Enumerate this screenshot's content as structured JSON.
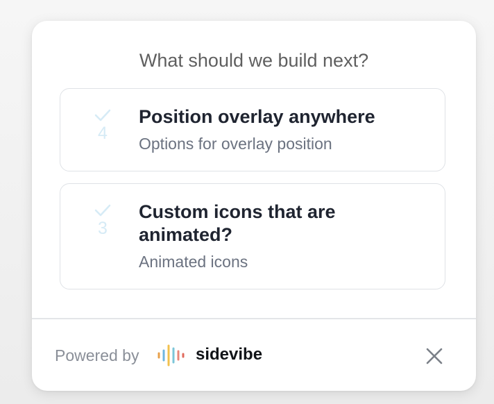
{
  "widget": {
    "title": "What should we build next?",
    "options": [
      {
        "count": "4",
        "title": "Position overlay anywhere",
        "subtitle": "Options for overlay position"
      },
      {
        "count": "3",
        "title": "Custom icons that are animated?",
        "subtitle": "Animated icons"
      }
    ]
  },
  "footer": {
    "powered_by": "Powered by",
    "brand": "sidevibe",
    "logo_icon": "sidevibe-waveform-logo",
    "close_icon": "close-icon"
  },
  "colors": {
    "vote_accent": "#d6ebf6",
    "title_text": "#1f2430",
    "subtitle_text": "#6b7280",
    "border": "#dfe2e6"
  }
}
